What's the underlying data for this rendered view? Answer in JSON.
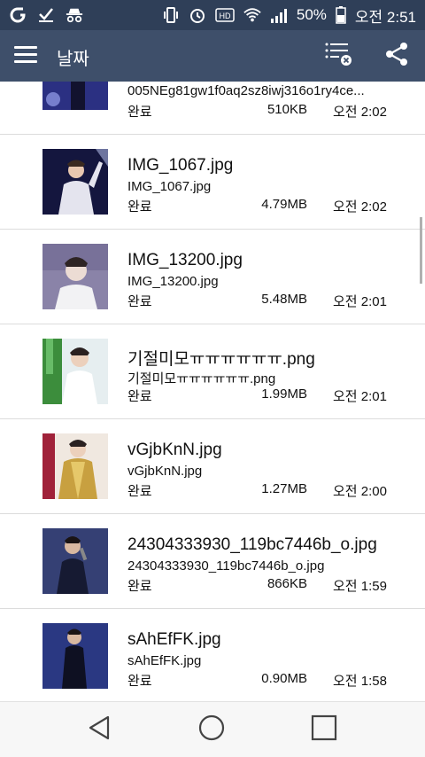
{
  "statusbar": {
    "battery": "50%",
    "time": "오전 2:51",
    "left_icons": [
      "app-icon",
      "check-icon",
      "incognito-icon"
    ],
    "right_icons": [
      "vibrate-icon",
      "alarm-icon",
      "hd-icon",
      "wifi-icon",
      "signal-icon",
      "battery-icon"
    ],
    "hd_label": "HD"
  },
  "toolbar": {
    "title": "날짜",
    "actions": [
      "clear-list-icon",
      "share-icon"
    ]
  },
  "downloads": [
    {
      "name": "",
      "subname": "005NEg81gw1f0aq2sz8iwj316o1ry4ce...",
      "status": "완료",
      "size": "510KB",
      "time": "오전 2:02",
      "thumb_colors": [
        "#1a1d4a",
        "#3a3fb0"
      ]
    },
    {
      "name": "IMG_1067.jpg",
      "subname": "IMG_1067.jpg",
      "status": "완료",
      "size": "4.79MB",
      "time": "오전 2:02",
      "thumb_colors": [
        "#14163e",
        "#d8d8e6"
      ]
    },
    {
      "name": "IMG_13200.jpg",
      "subname": "IMG_13200.jpg",
      "status": "완료",
      "size": "5.48MB",
      "time": "오전 2:01",
      "thumb_colors": [
        "#8a83a8",
        "#ecdcd4"
      ]
    },
    {
      "name": "기절미모ㅠㅠㅠㅠㅠㅠ.png",
      "subname": "기절미모ㅠㅠㅠㅠㅠㅠ.png",
      "status": "완료",
      "size": "1.99MB",
      "time": "오전 2:01",
      "thumb_colors": [
        "#3c8d3c",
        "#e6eef0"
      ]
    },
    {
      "name": "vGjbKnN.jpg",
      "subname": "vGjbKnN.jpg",
      "status": "완료",
      "size": "1.27MB",
      "time": "오전 2:00",
      "thumb_colors": [
        "#a0223a",
        "#c8a040"
      ]
    },
    {
      "name": "24304333930_119bc7446b_o.jpg",
      "subname": "24304333930_119bc7446b_o.jpg",
      "status": "완료",
      "size": "866KB",
      "time": "오전 1:59",
      "thumb_colors": [
        "#2a3460",
        "#161a32"
      ]
    },
    {
      "name": "sAhEfFK.jpg",
      "subname": "sAhEfFK.jpg",
      "status": "완료",
      "size": "0.90MB",
      "time": "오전 1:58",
      "thumb_colors": [
        "#1e2a6a",
        "#3a4aa0"
      ]
    }
  ],
  "navbar": [
    "back-icon",
    "home-icon",
    "recents-icon"
  ]
}
